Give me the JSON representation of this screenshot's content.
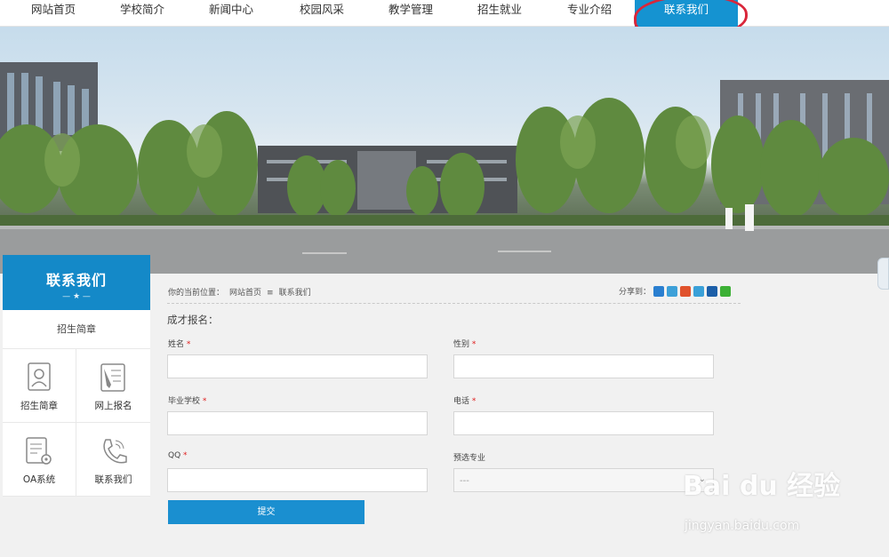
{
  "nav": {
    "items": [
      {
        "label": "网站首页"
      },
      {
        "label": "学校简介"
      },
      {
        "label": "新闻中心"
      },
      {
        "label": "校园风采"
      },
      {
        "label": "教学管理"
      },
      {
        "label": "招生就业"
      },
      {
        "label": "专业介绍"
      },
      {
        "label": "联系我们",
        "active": true
      }
    ]
  },
  "sidebar": {
    "title": "联系我们",
    "ornament": "— ★ —",
    "top_link": "招生简章",
    "grid": [
      {
        "label": "招生简章",
        "icon": "certificate-icon"
      },
      {
        "label": "网上报名",
        "icon": "pen-form-icon"
      },
      {
        "label": "OA系统",
        "icon": "document-gear-icon"
      },
      {
        "label": "联系我们",
        "icon": "phone-icon"
      }
    ]
  },
  "breadcrumb": {
    "prefix": "你的当前位置：",
    "home": "网站首页",
    "sep": "≡",
    "current": "联系我们"
  },
  "share": {
    "label": "分享到：",
    "icons": [
      {
        "name": "qzone-share-icon",
        "color": "#2a7fd0"
      },
      {
        "name": "tqq-share-icon",
        "color": "#3da0d8"
      },
      {
        "name": "weibo-share-icon",
        "color": "#e0522c"
      },
      {
        "name": "tieba-share-icon",
        "color": "#3aa0d8"
      },
      {
        "name": "renren-share-icon",
        "color": "#1c5fa8"
      },
      {
        "name": "wechat-share-icon",
        "color": "#3cb035"
      }
    ]
  },
  "form": {
    "title": "成才报名：",
    "fields": {
      "name": {
        "label": "姓名",
        "value": ""
      },
      "gender": {
        "label": "性别",
        "value": ""
      },
      "school": {
        "label": "毕业学校",
        "value": ""
      },
      "phone": {
        "label": "电话",
        "value": ""
      },
      "qq": {
        "label": "QQ",
        "value": ""
      },
      "major": {
        "label": "预选专业",
        "value": "---"
      }
    },
    "required_mark": "*",
    "submit": "提交"
  },
  "watermark": {
    "main": "Bai du 经验",
    "sub": "jingyan.baidu.com"
  },
  "colors": {
    "accent": "#1593d1",
    "annotation": "#d9263a"
  }
}
